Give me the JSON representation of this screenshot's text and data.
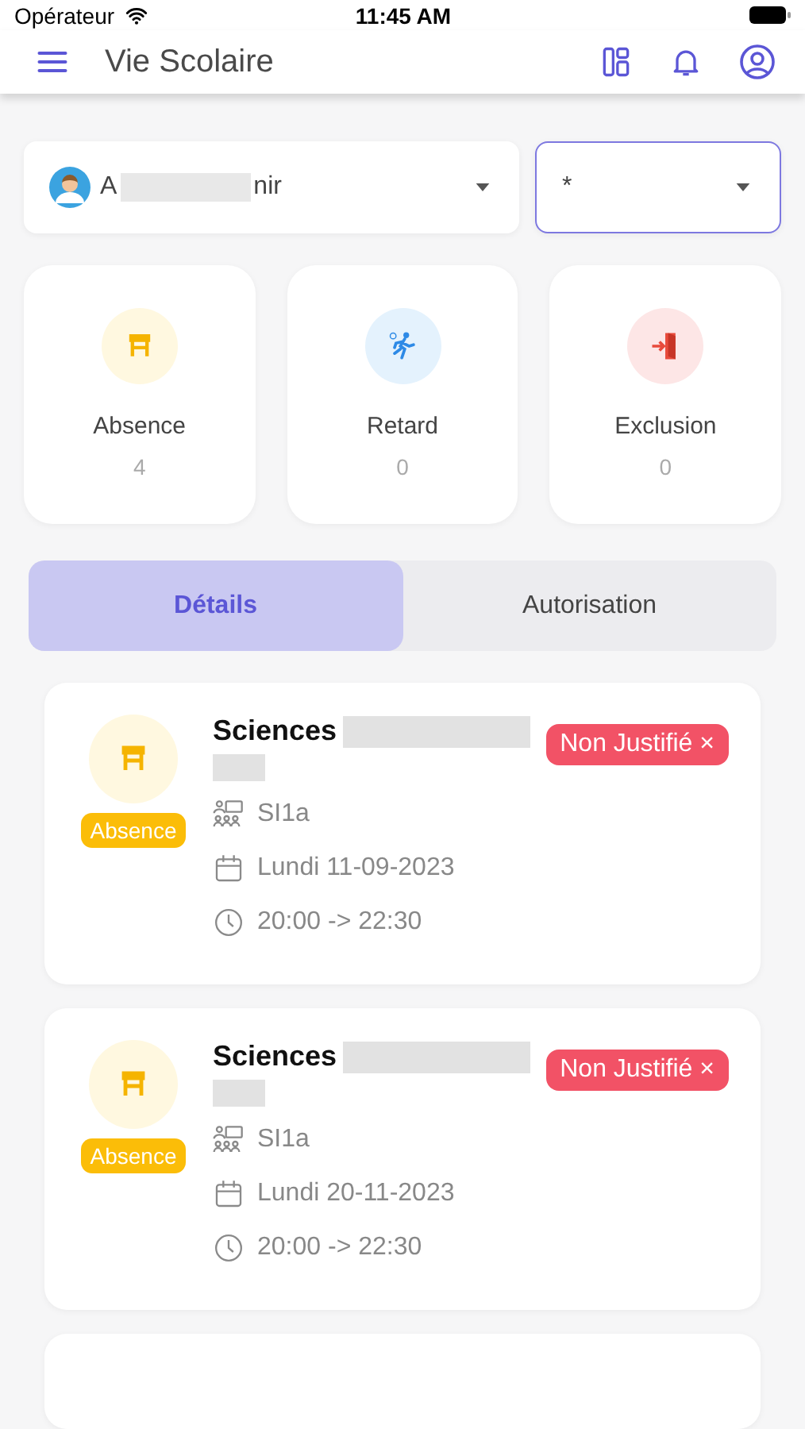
{
  "status_bar": {
    "carrier": "Opérateur",
    "time": "11:45 AM"
  },
  "header": {
    "title": "Vie Scolaire"
  },
  "filters": {
    "student": {
      "name_start": "A",
      "name_end": "nir"
    },
    "period": {
      "value": "*"
    }
  },
  "stats": [
    {
      "kind": "absence",
      "label": "Absence",
      "count": "4"
    },
    {
      "kind": "retard",
      "label": "Retard",
      "count": "0"
    },
    {
      "kind": "exclusion",
      "label": "Exclusion",
      "count": "0"
    }
  ],
  "tabs": [
    {
      "label": "Détails",
      "selected": true
    },
    {
      "label": "Autorisation",
      "selected": false
    }
  ],
  "records": [
    {
      "kind": "absence",
      "type": "Absence",
      "subject": "Sciences",
      "justified": false,
      "status": "Non Justifié",
      "status_icon": "×",
      "group": "SI1a",
      "date": "Lundi 11-09-2023",
      "time": "20:00 -> 22:30"
    },
    {
      "kind": "absence",
      "type": "Absence",
      "subject": "Sciences",
      "justified": false,
      "status": "Non Justifié",
      "status_icon": "×",
      "group": "SI1a",
      "date": "Lundi 20-11-2023",
      "time": "20:00 -> 22:30"
    }
  ]
}
